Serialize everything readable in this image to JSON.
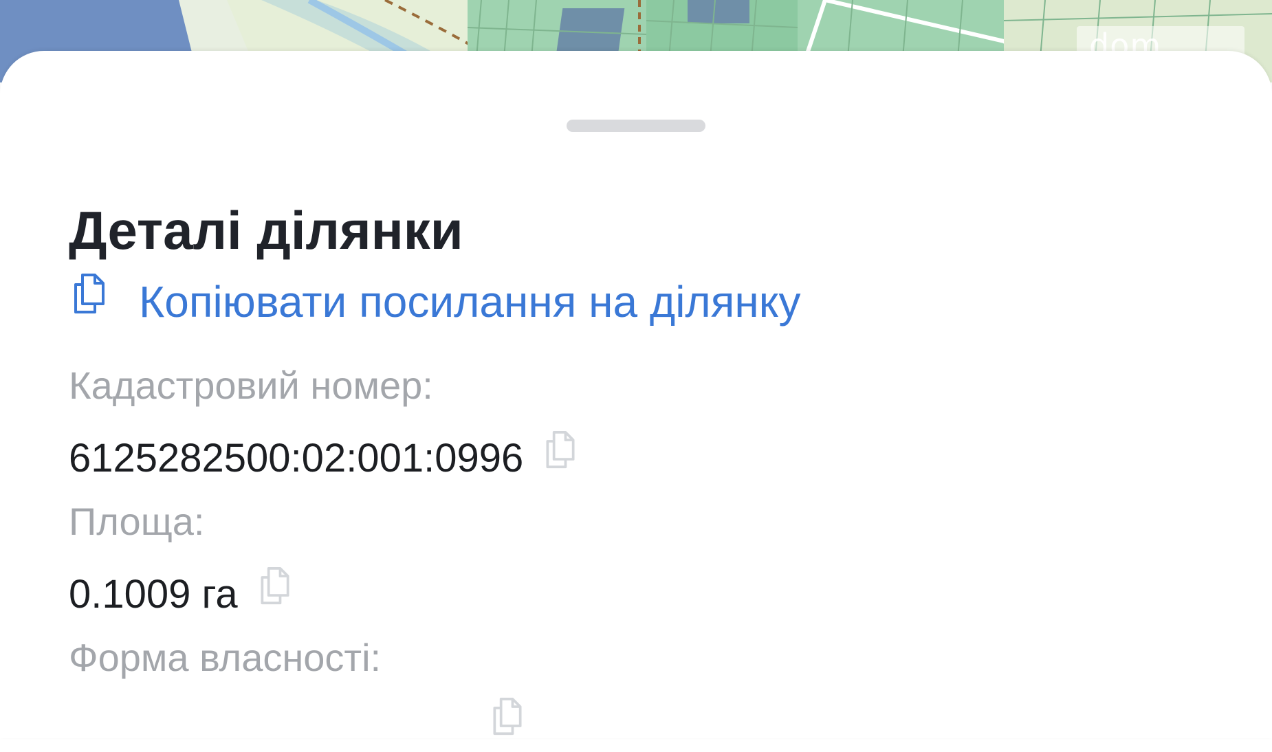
{
  "map": {
    "watermark_text": "dom"
  },
  "sheet": {
    "title": "Деталі ділянки",
    "copy_link": {
      "label": "Копіювати посилання на ділянку",
      "icon": "copy-icon"
    },
    "fields": [
      {
        "label": "Кадастровий номер:",
        "value": "6125282500:02:001:0996",
        "icon": "copy-icon"
      },
      {
        "label": "Площа:",
        "value": "0.1009 га",
        "icon": "copy-icon"
      },
      {
        "label": "Форма власності:",
        "value": "",
        "icon": "copy-icon"
      }
    ]
  },
  "colors": {
    "link": "#3a78d6",
    "title": "#20232a",
    "label": "#a3a6ab",
    "value": "#1c1e22",
    "map_water": "#5f7fb4",
    "map_green": "#8cc9a1"
  }
}
